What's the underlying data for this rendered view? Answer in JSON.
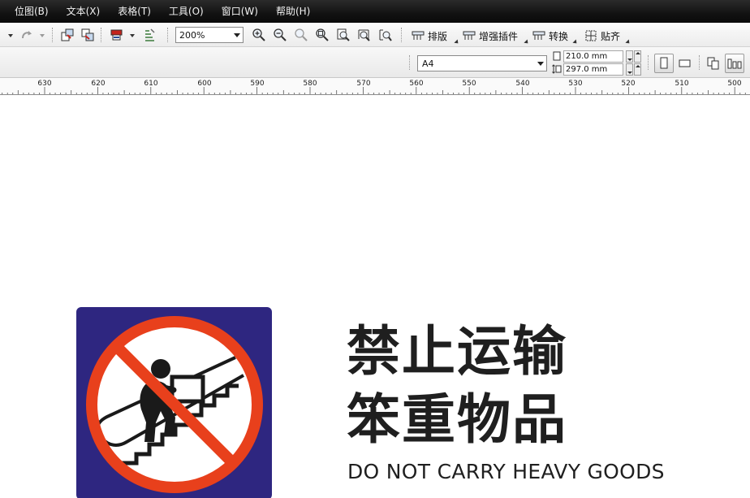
{
  "menu": {
    "items": [
      "位图(B)",
      "文本(X)",
      "表格(T)",
      "工具(O)",
      "窗口(W)",
      "帮助(H)"
    ]
  },
  "toolbar": {
    "zoom_value": "200%",
    "buttons": [
      "排版",
      "增强插件",
      "转换",
      "贴齐"
    ]
  },
  "property_bar": {
    "paper_size": "A4",
    "width": "210.0 mm",
    "height": "297.0 mm"
  },
  "ruler": {
    "labels": [
      "630",
      "620",
      "610",
      "600",
      "590",
      "580",
      "570",
      "560",
      "550",
      "540",
      "530",
      "520",
      "510",
      "500"
    ]
  },
  "sign": {
    "line1": "禁止运输",
    "line2": "笨重物品",
    "english": "DO NOT CARRY HEAVY GOODS",
    "colors": {
      "background": "#2e2680",
      "ring": "#e8401c",
      "figure": "#1a1a1a"
    }
  }
}
